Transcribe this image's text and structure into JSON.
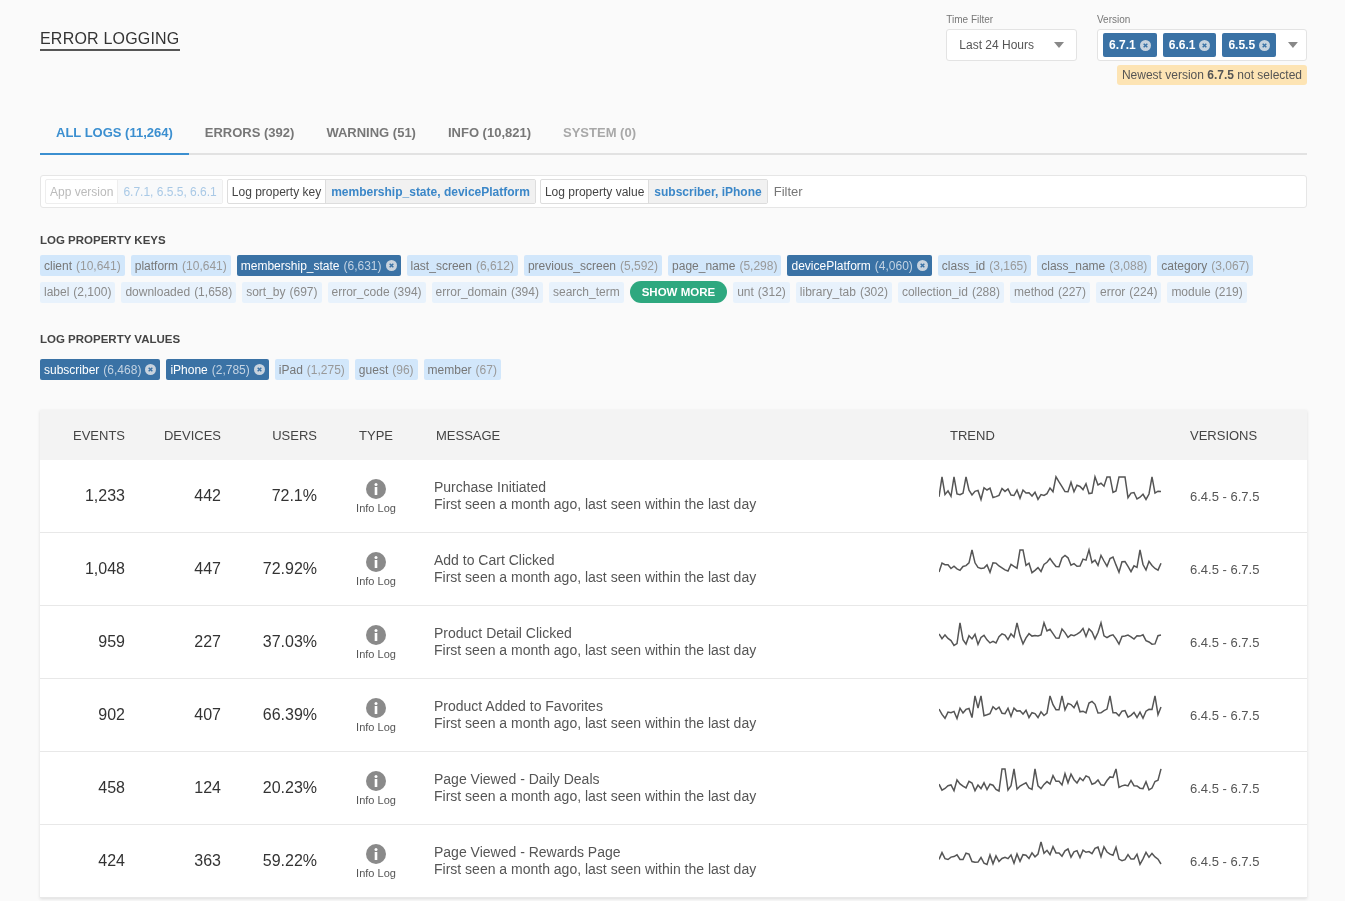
{
  "title": "ERROR LOGGING",
  "time_filter": {
    "label": "Time Filter",
    "value": "Last 24 Hours"
  },
  "version_filter": {
    "label": "Version",
    "chips": [
      "6.7.1",
      "6.6.1",
      "6.5.5"
    ],
    "notice": "Newest version **6.7.5** not selected"
  },
  "tabs": [
    {
      "label": "ALL LOGS (11,264)",
      "selected": true,
      "disabled": false
    },
    {
      "label": "ERRORS (392)",
      "selected": false,
      "disabled": false
    },
    {
      "label": "WARNING (51)",
      "selected": false,
      "disabled": false
    },
    {
      "label": "INFO (10,821)",
      "selected": false,
      "disabled": false
    },
    {
      "label": "SYSTEM (0)",
      "selected": false,
      "disabled": true
    }
  ],
  "filter_bar": {
    "segments": [
      {
        "key": "App version",
        "value": "6.7.1, 6.5.5, 6.6.1",
        "disabled": true
      },
      {
        "key": "Log property key",
        "value": "membership_state, devicePlatform",
        "disabled": false
      },
      {
        "key": "Log property value",
        "value": "subscriber, iPhone",
        "disabled": false
      }
    ],
    "placeholder": "Filter"
  },
  "property_keys": {
    "heading": "LOG PROPERTY KEYS",
    "show_more": "SHOW MORE",
    "chips": [
      {
        "label": "client",
        "count": "(10,641)",
        "selected": false
      },
      {
        "label": "platform",
        "count": "(10,641)",
        "selected": false
      },
      {
        "label": "membership_state",
        "count": "(6,631)",
        "selected": true
      },
      {
        "label": "last_screen",
        "count": "(6,612)",
        "selected": false
      },
      {
        "label": "previous_screen",
        "count": "(5,592)",
        "selected": false
      },
      {
        "label": "page_name",
        "count": "(5,298)",
        "selected": false
      },
      {
        "label": "devicePlatform",
        "count": "(4,060)",
        "selected": true
      },
      {
        "label": "class_id",
        "count": "(3,165)",
        "selected": false
      },
      {
        "label": "class_name",
        "count": "(3,088)",
        "selected": false
      },
      {
        "label": "category",
        "count": "(3,067)",
        "selected": false
      }
    ],
    "overflow_chips": [
      {
        "label": "label",
        "count": "(2,100)",
        "selected": false
      },
      {
        "label": "downloaded",
        "count": "(1,658)",
        "selected": false
      },
      {
        "label": "sort_by",
        "count": "(697)",
        "selected": false
      },
      {
        "label": "error_code",
        "count": "(394)",
        "selected": false
      },
      {
        "label": "error_domain",
        "count": "(394)",
        "selected": false
      },
      {
        "label": "search_term",
        "selected": false
      },
      {
        "kind": "show_more"
      },
      {
        "label": "unt",
        "count": "(312)",
        "selected": false
      },
      {
        "label": "library_tab",
        "count": "(302)",
        "selected": false
      },
      {
        "label": "collection_id",
        "count": "(288)",
        "selected": false
      },
      {
        "label": "method",
        "count": "(227)",
        "selected": false
      },
      {
        "label": "error",
        "count": "(224)",
        "selected": false
      },
      {
        "label": "module",
        "count": "(219)",
        "selected": false
      }
    ]
  },
  "property_values": {
    "heading": "LOG PROPERTY VALUES",
    "chips": [
      {
        "label": "subscriber",
        "count": "(6,468)",
        "selected": true
      },
      {
        "label": "iPhone",
        "count": "(2,785)",
        "selected": true
      },
      {
        "label": "iPad",
        "count": "(1,275)",
        "selected": false
      },
      {
        "label": "guest",
        "count": "(96)",
        "selected": false
      },
      {
        "label": "member",
        "count": "(67)",
        "selected": false
      }
    ]
  },
  "table": {
    "columns": [
      "EVENTS",
      "DEVICES",
      "USERS",
      "TYPE",
      "MESSAGE",
      "TREND",
      "VERSIONS"
    ],
    "rows": [
      {
        "events": "1,233",
        "devices": "442",
        "users": "72.1%",
        "type": "Info Log",
        "title": "Purchase Initiated",
        "detail": "First seen a month ago, last seen within the last day",
        "versions": "6.4.5 - 6.7.5"
      },
      {
        "events": "1,048",
        "devices": "447",
        "users": "72.92%",
        "type": "Info Log",
        "title": "Add to Cart Clicked",
        "detail": "First seen a month ago, last seen within the last day",
        "versions": "6.4.5 - 6.7.5"
      },
      {
        "events": "959",
        "devices": "227",
        "users": "37.03%",
        "type": "Info Log",
        "title": "Product Detail Clicked",
        "detail": "First seen a month ago, last seen within the last day",
        "versions": "6.4.5 - 6.7.5"
      },
      {
        "events": "902",
        "devices": "407",
        "users": "66.39%",
        "type": "Info Log",
        "title": "Product Added to Favorites",
        "detail": "First seen a month ago, last seen within the last day",
        "versions": "6.4.5 - 6.7.5"
      },
      {
        "events": "458",
        "devices": "124",
        "users": "20.23%",
        "type": "Info Log",
        "title": "Page Viewed - Daily Deals",
        "detail": "First seen a month ago, last seen within the last day",
        "versions": "6.4.5 - 6.7.5"
      },
      {
        "events": "424",
        "devices": "363",
        "users": "59.22%",
        "type": "Info Log",
        "title": "Page Viewed - Rewards Page",
        "detail": "First seen a month ago, last seen within the last day",
        "versions": "6.4.5 - 6.7.5"
      }
    ]
  }
}
